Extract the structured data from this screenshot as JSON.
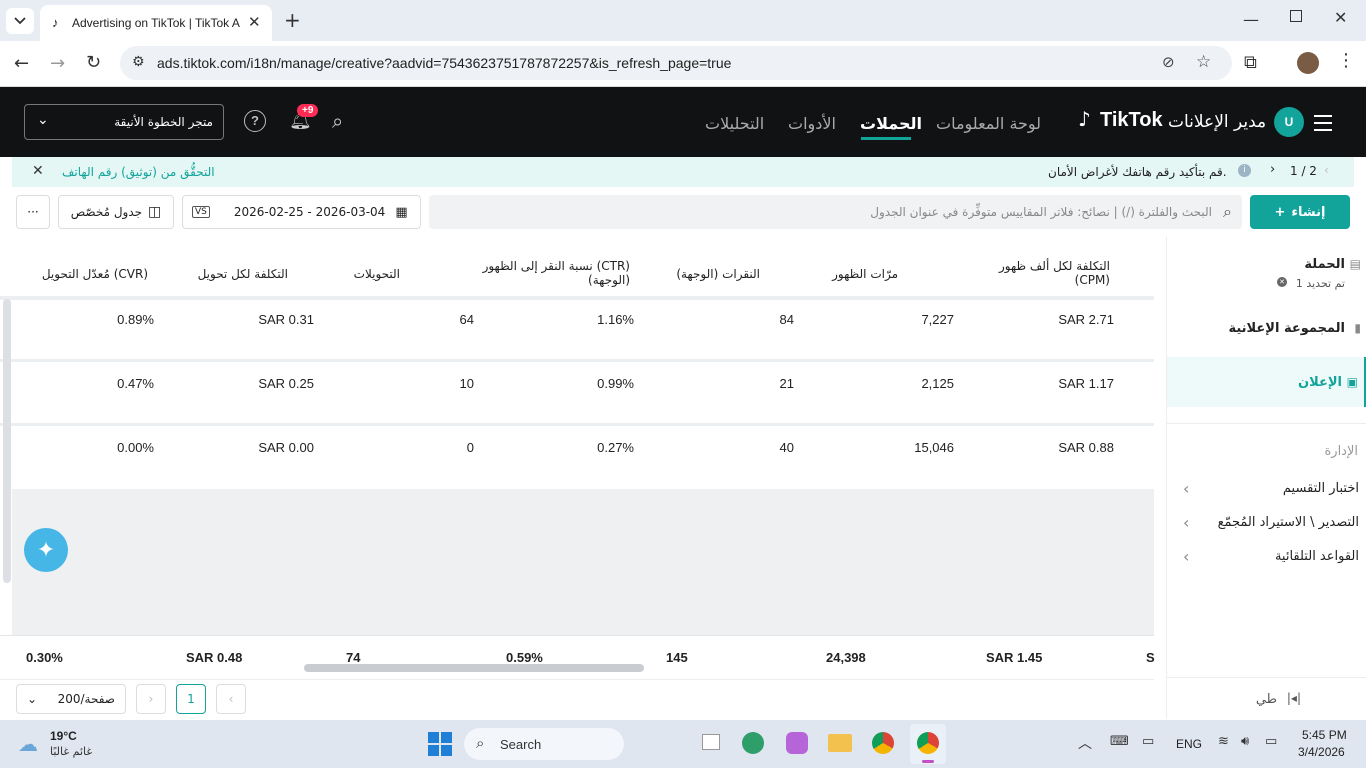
{
  "browser": {
    "tab_title": "Advertising on TikTok | TikTok A",
    "url": "ads.tiktok.com/i18n/manage/creative?aadvid=7543623751787872257&is_refresh_page=true"
  },
  "header": {
    "brand": "TikTok",
    "brand_suffix": "مدير الإعلانات",
    "avatar_letter": "U",
    "nav": [
      "لوحة المعلومات",
      "الحملات",
      "الأدوات",
      "التحليلات"
    ],
    "active_nav": "الحملات",
    "notif_badge": "+9",
    "account_name": "متجر الخطوة الأنيقة"
  },
  "notice": {
    "pager": "1 / 2",
    "message": "قم بتأكيد رقم هاتفك لأغراض الأمان.",
    "link": "التحقُّق من (توثيق) رقم الهاتف"
  },
  "toolbar": {
    "create_label": "إنشاء",
    "search_placeholder": "البحث والفلترة (/) | نصائح: فلاتر المقاييس متوفِّرة في عنوان الجدول",
    "date_range": "2026-02-25 - 2026-03-04",
    "vs_label": "VS",
    "custom_table_label": "جدول مُخصّص",
    "more_label": "···"
  },
  "table": {
    "columns": [
      "التكلفة لكل ألف ظهور (CPM)",
      "مرّات الظهور",
      "النقرات (الوجهة)",
      "نسبة النقر إلى الظهور (CTR) (الوجهة)",
      "التحويلات",
      "التكلفة لكل تحويل",
      "مُعدّل التحويل (CVR)"
    ],
    "rows": [
      [
        "SAR 2.71",
        "7,227",
        "84",
        "1.16%",
        "64",
        "SAR 0.31",
        "0.89%"
      ],
      [
        "SAR 1.17",
        "2,125",
        "21",
        "0.99%",
        "10",
        "SAR 0.25",
        "0.47%"
      ],
      [
        "SAR 0.88",
        "15,046",
        "40",
        "0.27%",
        "0",
        "SAR 0.00",
        "0.00%"
      ]
    ],
    "totals": [
      "SAR 1.45",
      "24,398",
      "145",
      "0.59%",
      "74",
      "SAR 0.48",
      "0.30%"
    ],
    "totals_edge": "S"
  },
  "pagination": {
    "page": "1",
    "per_page": "200/صفحة"
  },
  "sidebar": {
    "campaign": "الحملة",
    "campaign_sub": "1 تم تحديد",
    "adgroup": "المجموعة الإعلانية",
    "ad": "الإعلان",
    "management": "الإدارة",
    "items": [
      "اختبار التقسيم",
      "التصدير \\ الاستيراد المُجمّع",
      "القواعد التلقائية"
    ],
    "collapse": "طي"
  },
  "taskbar": {
    "weather_temp": "19°C",
    "weather_desc": "غائم غالبًا",
    "search": "Search",
    "lang": "ENG",
    "time": "5:45 PM",
    "date": "3/4/2026"
  },
  "colors": {
    "accent": "#12a39a",
    "header_bg": "#111214",
    "badge": "#fe2c55"
  }
}
